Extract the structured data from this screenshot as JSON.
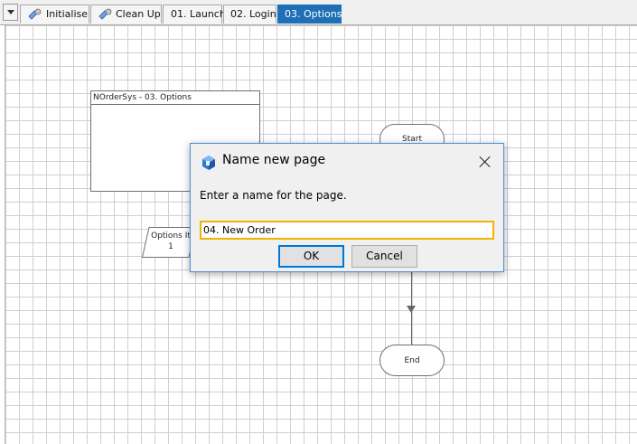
{
  "tabs": [
    {
      "label": "Initialise",
      "icon": "process-icon"
    },
    {
      "label": "Clean Up",
      "icon": "process-icon"
    },
    {
      "label": "01. Launch"
    },
    {
      "label": "02. Login"
    },
    {
      "label": "03. Options",
      "active": true
    }
  ],
  "canvas": {
    "page_box_title": "NOrderSys - 03. Options",
    "start_label": "Start",
    "end_label": "End",
    "data_item_label": "Options It",
    "data_item_value": "1"
  },
  "dialog": {
    "title": "Name new page",
    "prompt": "Enter a name for the page.",
    "input_value": "04. New Order",
    "ok_label": "OK",
    "cancel_label": "Cancel"
  },
  "colors": {
    "active_tab": "#1e6fb5",
    "input_focus_border": "#f0b400",
    "dialog_border": "#4a90d9"
  }
}
